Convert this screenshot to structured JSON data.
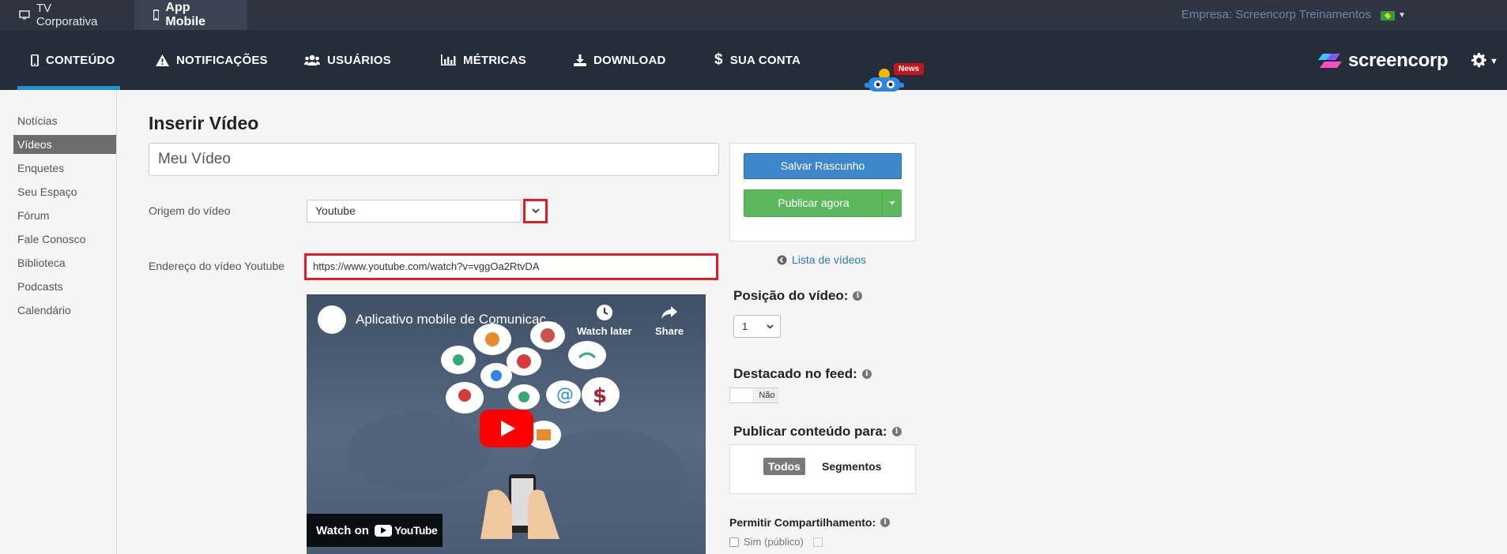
{
  "topbar": {
    "tabs": [
      {
        "label": "TV Corporativa",
        "icon": "monitor-icon"
      },
      {
        "label": "App Mobile",
        "icon": "mobile-icon"
      }
    ],
    "company": "Empresa: Screencorp Treinamentos",
    "language_flag": "brazil-flag-icon"
  },
  "nav": {
    "items": [
      {
        "label": "CONTEÚDO",
        "icon": "mobile-icon",
        "active": true
      },
      {
        "label": "NOTIFICAÇÕES",
        "icon": "warning-icon"
      },
      {
        "label": "USUÁRIOS",
        "icon": "users-icon"
      },
      {
        "label": "MÉTRICAS",
        "icon": "bar-chart-icon"
      },
      {
        "label": "DOWNLOAD",
        "icon": "download-icon"
      },
      {
        "label": "SUA CONTA",
        "icon": "dollar-icon"
      }
    ],
    "news_badge": "News",
    "logo_text": "screencorp"
  },
  "sidebar": {
    "items": [
      {
        "label": "Notícias"
      },
      {
        "label": "Vídeos",
        "active": true
      },
      {
        "label": "Enquetes"
      },
      {
        "label": "Seu Espaço"
      },
      {
        "label": "Fórum"
      },
      {
        "label": "Fale Conosco"
      },
      {
        "label": "Biblioteca"
      },
      {
        "label": "Podcasts"
      },
      {
        "label": "Calendário"
      }
    ]
  },
  "main": {
    "title": "Inserir Vídeo",
    "video_title_value": "Meu Vídeo",
    "origin_label": "Origem do vídeo",
    "origin_value": "Youtube",
    "url_label": "Endereço do vídeo Youtube",
    "url_value": "https://www.youtube.com/watch?v=vggOa2RtvDA",
    "video": {
      "title": "Aplicativo mobile de Comunicaç...",
      "watch_later": "Watch later",
      "share": "Share",
      "watch_on": "Watch on",
      "youtube": "YouTube"
    }
  },
  "panel": {
    "save_draft": "Salvar Rascunho",
    "publish_now": "Publicar agora",
    "video_list": "Lista de vídeos",
    "position_label": "Posição do vídeo:",
    "position_value": "1",
    "featured_label": "Destacado no feed:",
    "featured_value": "Não",
    "publish_for_label": "Publicar conteúdo para:",
    "publish_for_options": [
      "Todos",
      "Segmentos"
    ],
    "allow_share_label": "Permitir Compartilhamento:",
    "allow_share_option": "Sim (público)"
  },
  "colors": {
    "topbar": "#2e3440",
    "navbar": "#252d3b",
    "accent_blue": "#1e90d8",
    "save_button": "#3e87cb",
    "publish_button": "#5cb85c",
    "highlight_red": "#e31b23",
    "news_red": "#c4141c"
  }
}
